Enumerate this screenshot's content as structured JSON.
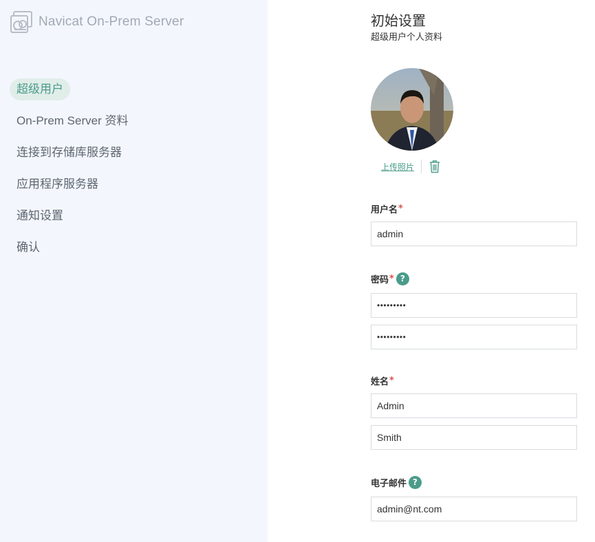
{
  "app": {
    "name": "Navicat On-Prem Server"
  },
  "sidebar": {
    "items": [
      {
        "label": "超级用户",
        "active": true
      },
      {
        "label": "On-Prem Server 资料",
        "active": false
      },
      {
        "label": "连接到存储库服务器",
        "active": false
      },
      {
        "label": "应用程序服务器",
        "active": false
      },
      {
        "label": "通知设置",
        "active": false
      },
      {
        "label": "确认",
        "active": false
      }
    ]
  },
  "main": {
    "title": "初始设置",
    "subtitle": "超级用户个人资料",
    "photo": {
      "upload_label": "上传照片",
      "delete_icon": "trash-icon"
    },
    "form": {
      "username": {
        "label": "用户名",
        "required_mark": "*",
        "value": "admin"
      },
      "password": {
        "label": "密码",
        "required_mark": "*",
        "help": "?",
        "value": "•••••••••",
        "confirm_value": "•••••••••"
      },
      "name": {
        "label": "姓名",
        "required_mark": "*",
        "first_value": "Admin",
        "last_value": "Smith"
      },
      "email": {
        "label": "电子邮件",
        "help": "?",
        "value": "admin@nt.com"
      }
    }
  },
  "colors": {
    "accent": "#4a9c8a",
    "sidebar_bg": "#f3f7fd",
    "required": "#d9534f"
  }
}
